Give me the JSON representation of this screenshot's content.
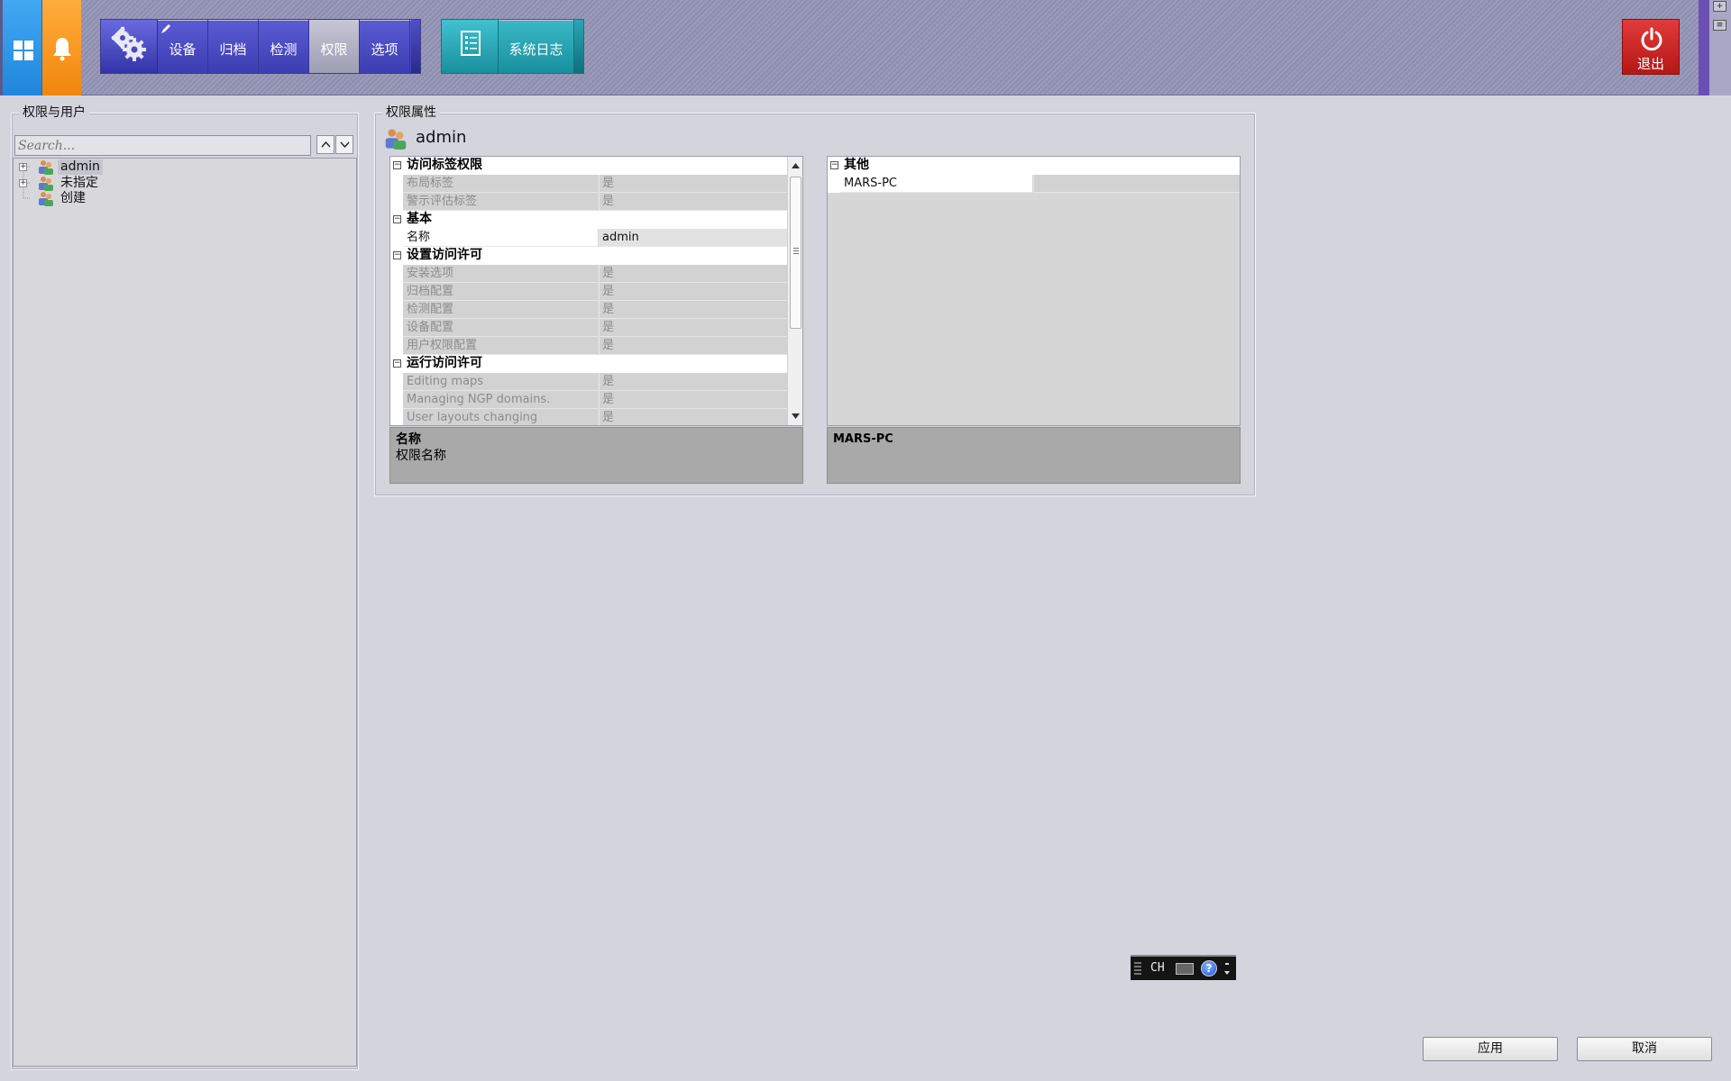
{
  "toolbar": {
    "settings_tabs": [
      {
        "label": "设备",
        "active": false
      },
      {
        "label": "归档",
        "active": false
      },
      {
        "label": "检测",
        "active": false
      },
      {
        "label": "权限",
        "active": true
      },
      {
        "label": "选项",
        "active": false
      }
    ],
    "log_tab": "系统日志",
    "exit_label": "退出",
    "colors": {
      "home": "#2f97e8",
      "bell": "#f7991f",
      "settings": "#4a4ac4",
      "log": "#25a3b2",
      "exit": "#cc2222"
    }
  },
  "left_panel": {
    "title": "权限与用户",
    "search_placeholder": "Search...",
    "tree": [
      {
        "label": "admin",
        "expandable": true,
        "selected": true
      },
      {
        "label": "未指定",
        "expandable": true,
        "selected": false
      },
      {
        "label": "创建",
        "expandable": false,
        "selected": false
      }
    ]
  },
  "props_panel": {
    "title": "权限属性",
    "user_name": "admin",
    "left_grid": {
      "sections": [
        {
          "title": "访问标签权限",
          "items": [
            {
              "name": "布局标签",
              "value": "是",
              "editable": false
            },
            {
              "name": "警示评估标签",
              "value": "是",
              "editable": false
            }
          ]
        },
        {
          "title": "基本",
          "items": [
            {
              "name": "名称",
              "value": "admin",
              "editable": true
            }
          ]
        },
        {
          "title": "设置访问许可",
          "items": [
            {
              "name": "安装选项",
              "value": "是",
              "editable": false
            },
            {
              "name": "归档配置",
              "value": "是",
              "editable": false
            },
            {
              "name": "检测配置",
              "value": "是",
              "editable": false
            },
            {
              "name": "设备配置",
              "value": "是",
              "editable": false
            },
            {
              "name": "用户权限配置",
              "value": "是",
              "editable": false
            }
          ]
        },
        {
          "title": "运行访问许可",
          "items": [
            {
              "name": "Editing maps",
              "value": "是",
              "editable": false
            },
            {
              "name": "Managing NGP domains.",
              "value": "是",
              "editable": false
            },
            {
              "name": "User layouts changing",
              "value": "是",
              "editable": false
            }
          ]
        }
      ],
      "desc_title": "名称",
      "desc_text": "权限名称"
    },
    "right_grid": {
      "sections": [
        {
          "title": "其他",
          "items": [
            {
              "name": "MARS-PC",
              "value": "",
              "editable": true
            }
          ]
        }
      ],
      "desc_title": "MARS-PC",
      "desc_text": ""
    }
  },
  "ime": {
    "lang": "CH",
    "help": "?"
  },
  "buttons": {
    "apply": "应用",
    "cancel": "取消"
  }
}
